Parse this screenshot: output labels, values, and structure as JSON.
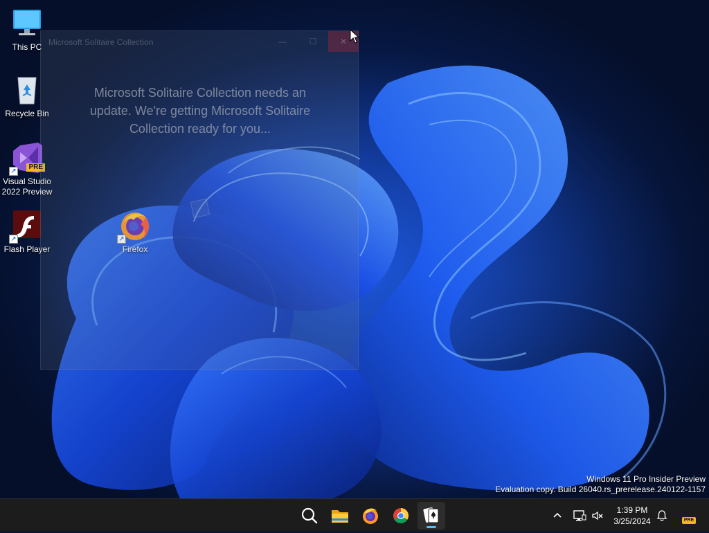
{
  "desktop": {
    "icons": [
      {
        "label": "This PC"
      },
      {
        "label": "Recycle Bin"
      },
      {
        "label": "Visual Studio 2022 Preview",
        "badge": "PRE"
      },
      {
        "label": "Flash Player"
      },
      {
        "label": "Firefox"
      }
    ]
  },
  "solitaire_window": {
    "title": "Microsoft Solitaire Collection",
    "message": "Microsoft Solitaire Collection needs an update. We're getting Microsoft Solitaire Collection ready for you...",
    "minimize_glyph": "—",
    "maximize_glyph": "☐",
    "close_glyph": "✕"
  },
  "watermark": {
    "line1": "Windows 11 Pro Insider Preview",
    "line2": "Evaluation copy. Build 26040.rs_prerelease.240122-1157"
  },
  "taskbar": {
    "apps": [
      {
        "name": "search-icon"
      },
      {
        "name": "file-explorer-icon"
      },
      {
        "name": "firefox-icon"
      },
      {
        "name": "chrome-icon"
      },
      {
        "name": "solitaire-icon",
        "active": true
      }
    ],
    "tray": {
      "time": "1:39 PM",
      "date": "3/25/2024",
      "pre_badge": "PRE"
    }
  },
  "colors": {
    "accent": "#4cc2ff",
    "taskbar": "#1c1c1c",
    "wallpaper_blue": "#1450e0"
  }
}
